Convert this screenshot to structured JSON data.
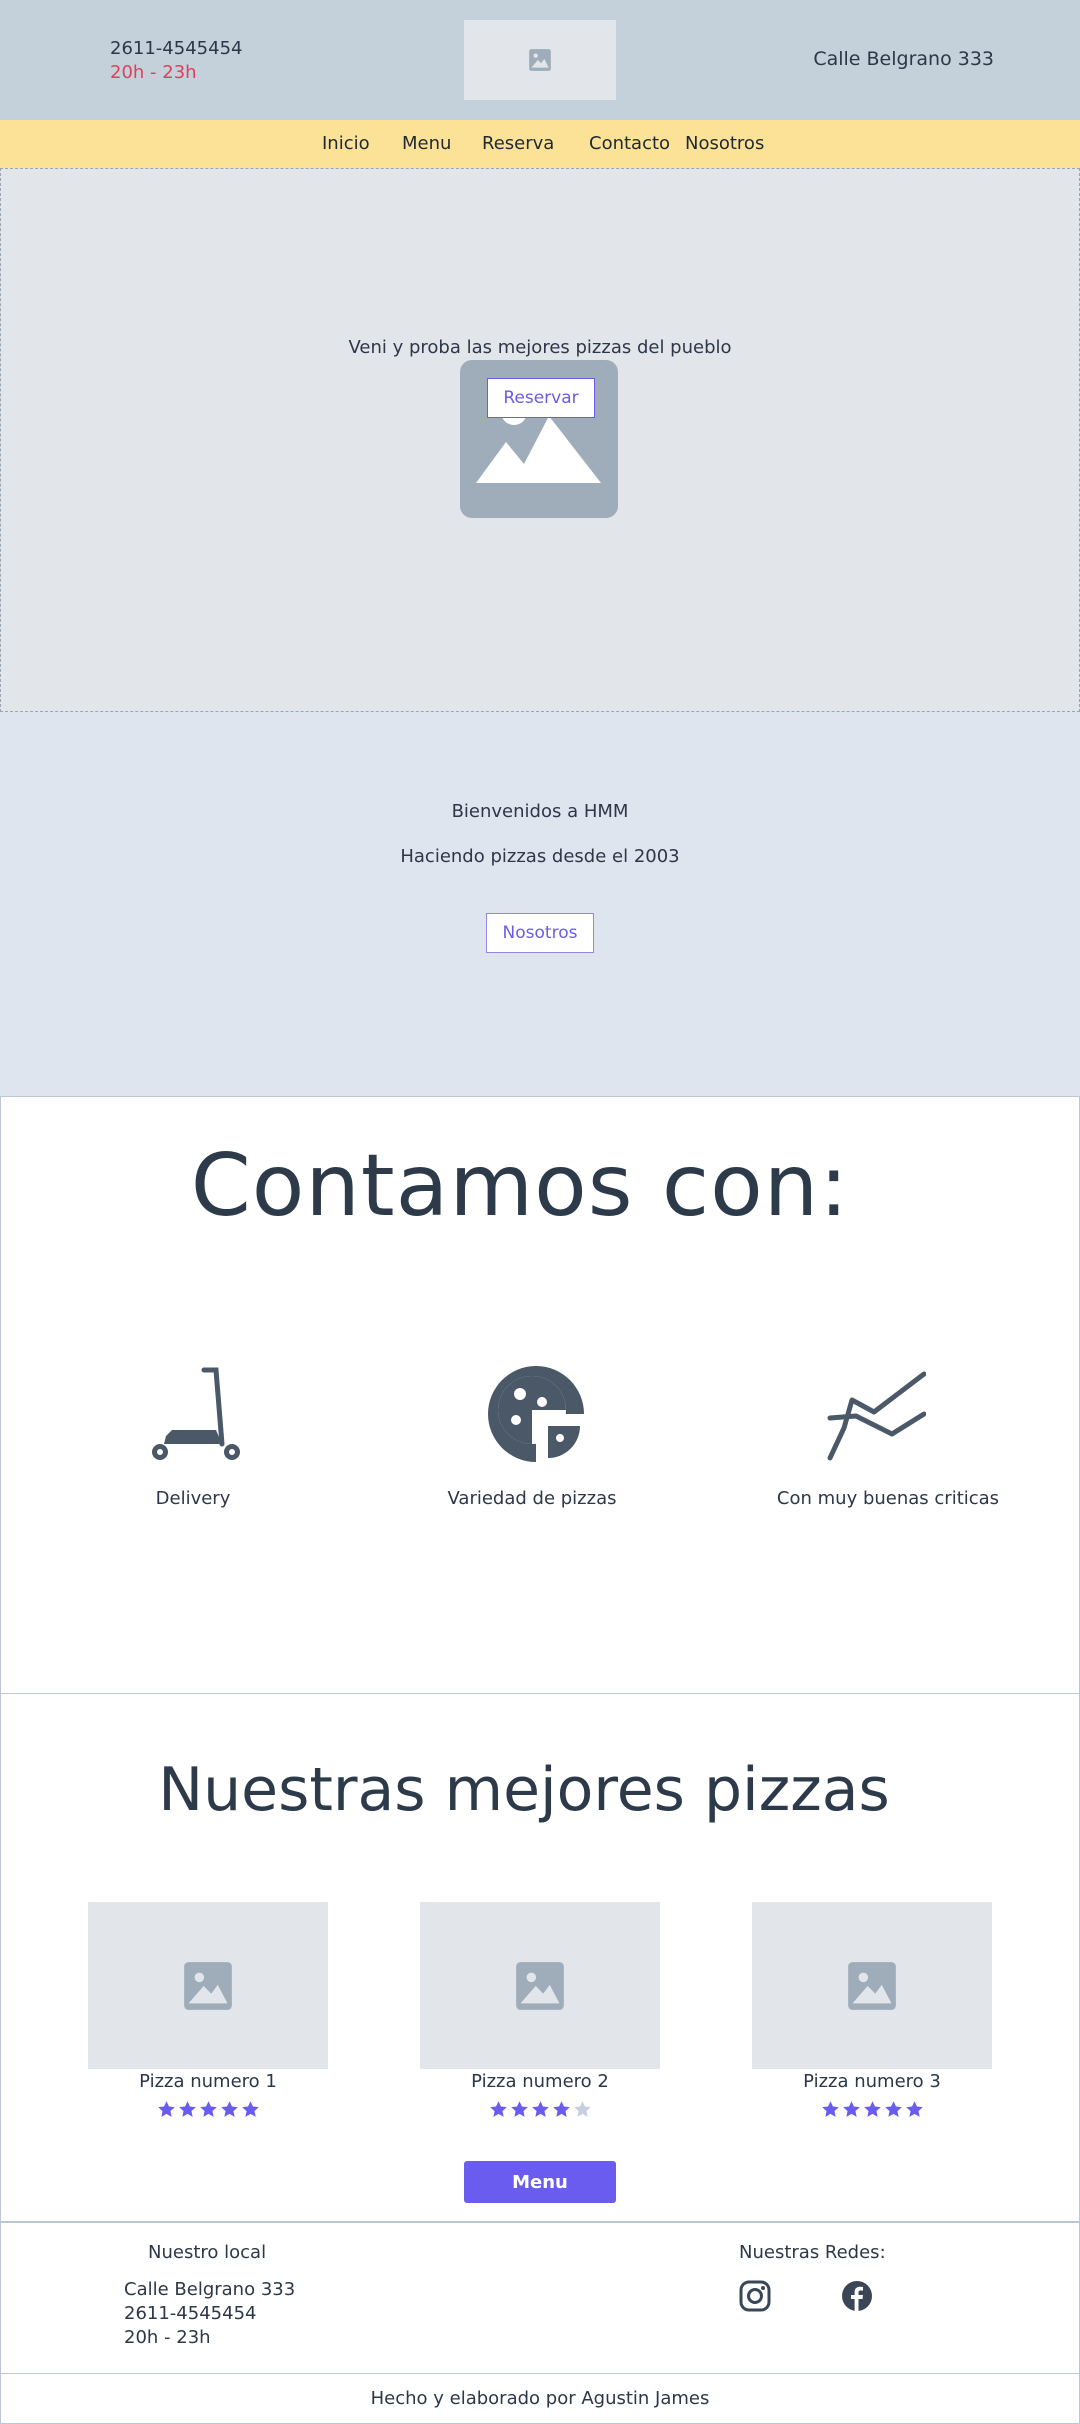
{
  "header": {
    "phone": "2611-4545454",
    "hours": "20h - 23h",
    "address": "Calle Belgrano 333",
    "logo_icon": "image-placeholder-icon"
  },
  "nav": {
    "items": [
      {
        "label": "Inicio"
      },
      {
        "label": "Menu"
      },
      {
        "label": "Reserva"
      },
      {
        "label": "Contacto"
      },
      {
        "label": "Nosotros"
      }
    ]
  },
  "hero": {
    "tagline": "Veni y proba las mejores pizzas del pueblo",
    "button_label": "Reservar",
    "image_icon": "mountain-image-icon"
  },
  "welcome": {
    "title": "Bienvenidos a HMM",
    "subtitle": "Haciendo pizzas desde el 2003",
    "button_label": "Nosotros"
  },
  "features": {
    "title": "Contamos con:",
    "items": [
      {
        "label": "Delivery",
        "icon": "scooter-icon"
      },
      {
        "label": "Variedad de pizzas",
        "icon": "pizza-icon"
      },
      {
        "label": "Con muy buenas criticas",
        "icon": "trend-chart-icon"
      }
    ]
  },
  "pizzas": {
    "title": "Nuestras mejores pizzas",
    "items": [
      {
        "name": "Pizza numero 1",
        "rating": 5,
        "max": 5
      },
      {
        "name": "Pizza numero 2",
        "rating": 4,
        "max": 5
      },
      {
        "name": "Pizza numero 3",
        "rating": 5,
        "max": 5
      }
    ],
    "menu_button": "Menu"
  },
  "footer": {
    "local_title": "Nuestro local",
    "address": "Calle Belgrano 333",
    "phone": "2611-4545454",
    "hours": "20h - 23h",
    "social_title": "Nuestras Redes:",
    "social": [
      "instagram-icon",
      "facebook-icon"
    ],
    "credits": "Hecho y elaborado por Agustin James"
  },
  "colors": {
    "header_bg": "#c4d0da",
    "nav_bg": "#fbe296",
    "accent": "#6b5cf0",
    "hours": "#e0405a",
    "star_on": "#6b5cf0",
    "star_off": "#c9cfe0"
  }
}
